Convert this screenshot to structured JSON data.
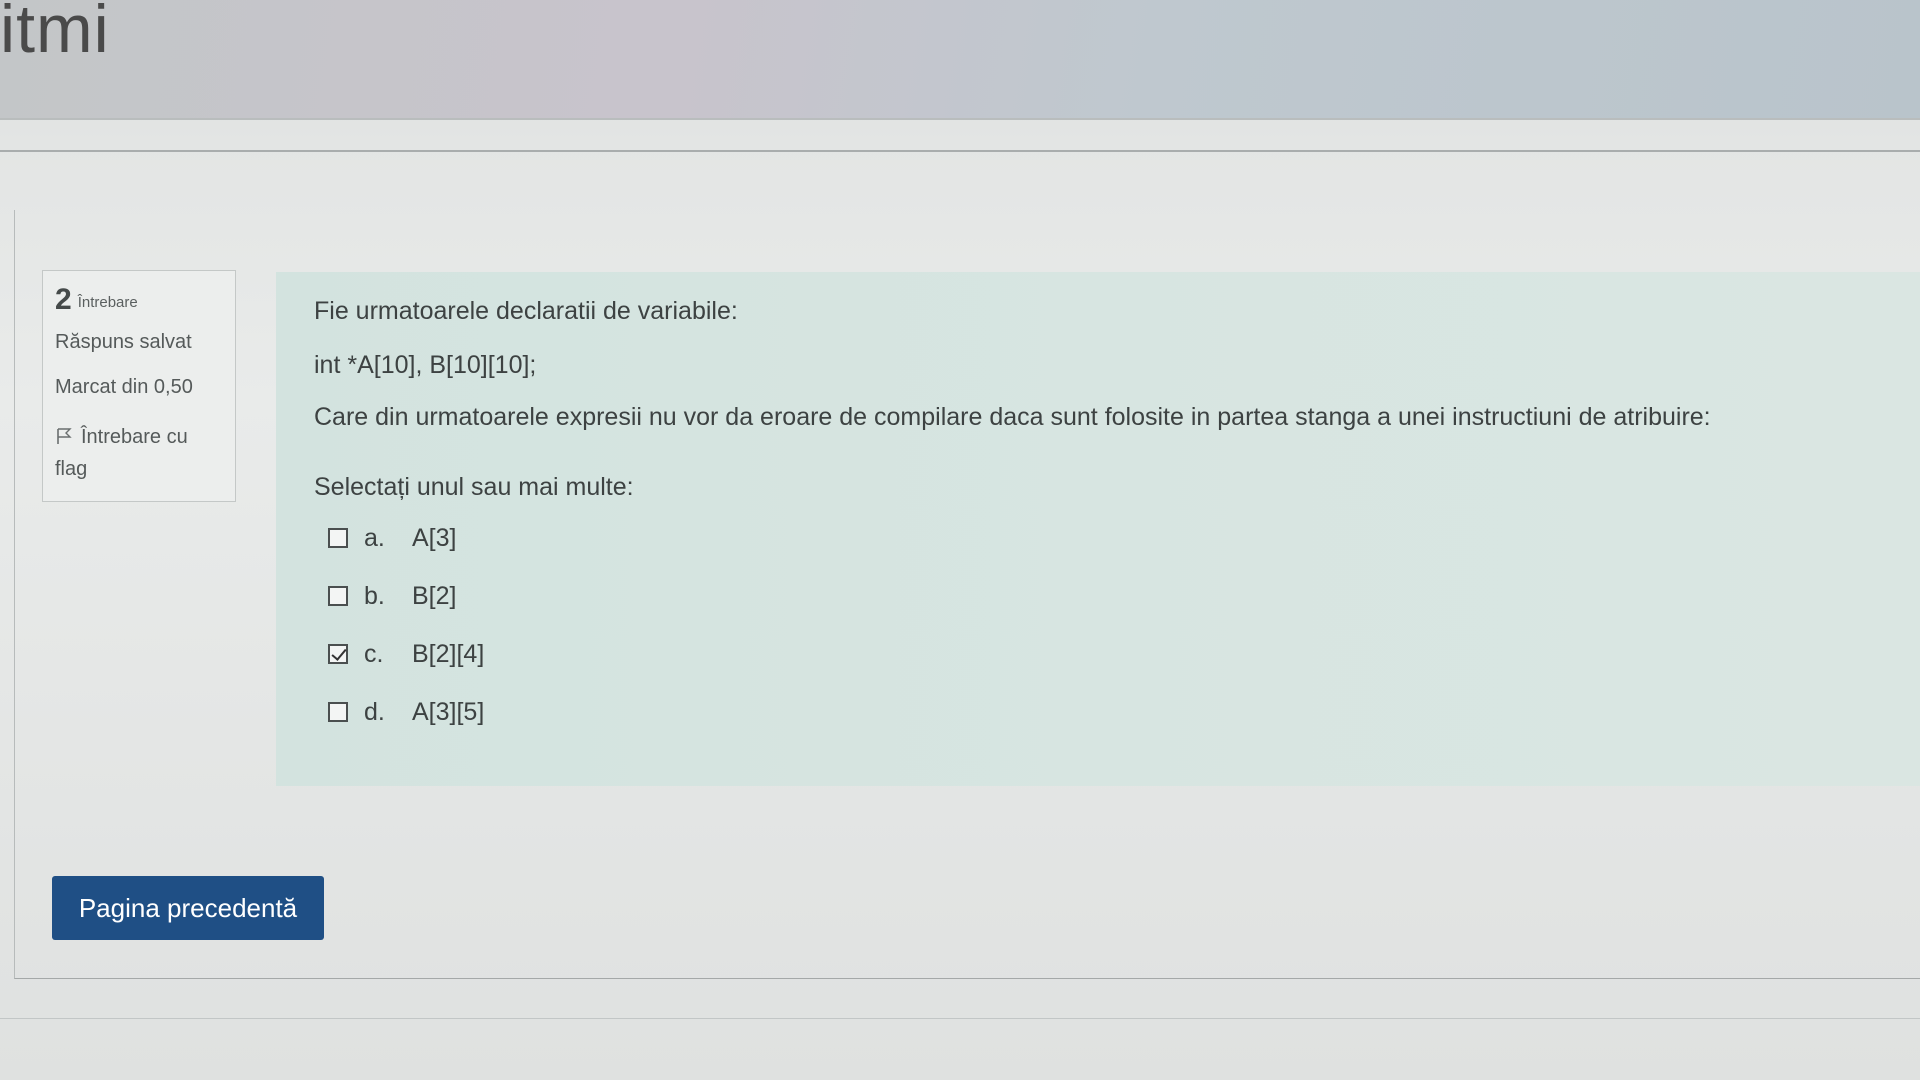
{
  "header": {
    "title": "itmi"
  },
  "info": {
    "number": "2",
    "question_label": "Întrebare",
    "status": "Răspuns salvat",
    "marks": "Marcat din 0,50",
    "flag_label": "Întrebare cu flag",
    "flag_icon": "flag-icon"
  },
  "question": {
    "text": "Fie urmatoarele declaratii de variabile:",
    "code": "int *A[10], B[10][10];",
    "prompt": "Care din urmatoarele expresii nu vor da eroare de compilare daca sunt folosite in partea stanga a unei instructiuni de atribuire:",
    "select_label": "Selectați unul sau mai multe:",
    "options": [
      {
        "letter": "a.",
        "text": "A[3]",
        "checked": false
      },
      {
        "letter": "b.",
        "text": "B[2]",
        "checked": false
      },
      {
        "letter": "c.",
        "text": "B[2][4]",
        "checked": true
      },
      {
        "letter": "d.",
        "text": "A[3][5]",
        "checked": false
      }
    ]
  },
  "nav": {
    "prev_label": "Pagina precedentă"
  },
  "colors": {
    "button_bg": "#1f4f85",
    "question_bg": "#d7e5e1"
  }
}
